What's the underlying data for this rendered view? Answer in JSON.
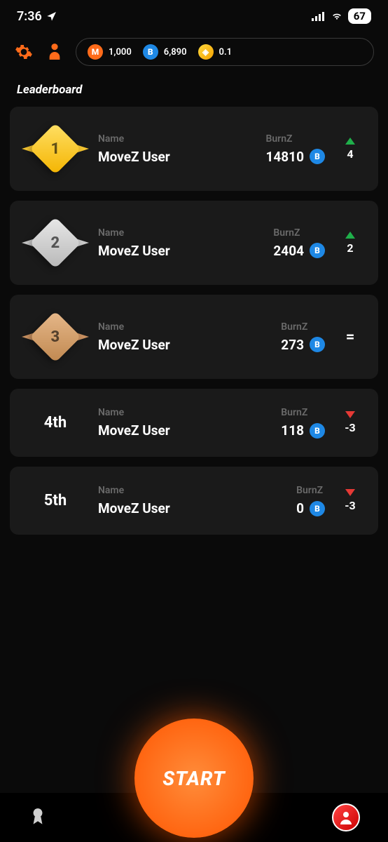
{
  "status": {
    "time": "7:36",
    "battery": "67"
  },
  "balances": {
    "m": "1,000",
    "b": "6,890",
    "y": "0.1"
  },
  "section_title": "Leaderboard",
  "name_label": "Name",
  "burnz_label": "BurnZ",
  "leaderboard": [
    {
      "rank": "1",
      "rank_display": "",
      "name": "MoveZ User",
      "burnz": "14810",
      "change": "4",
      "direction": "up"
    },
    {
      "rank": "2",
      "rank_display": "",
      "name": "MoveZ User",
      "burnz": "2404",
      "change": "2",
      "direction": "up"
    },
    {
      "rank": "3",
      "rank_display": "",
      "name": "MoveZ User",
      "burnz": "273",
      "change": "=",
      "direction": "same"
    },
    {
      "rank": "4",
      "rank_display": "4th",
      "name": "MoveZ User",
      "burnz": "118",
      "change": "-3",
      "direction": "down"
    },
    {
      "rank": "5",
      "rank_display": "5th",
      "name": "MoveZ User",
      "burnz": "0",
      "change": "-3",
      "direction": "down"
    }
  ],
  "start_button": "START"
}
